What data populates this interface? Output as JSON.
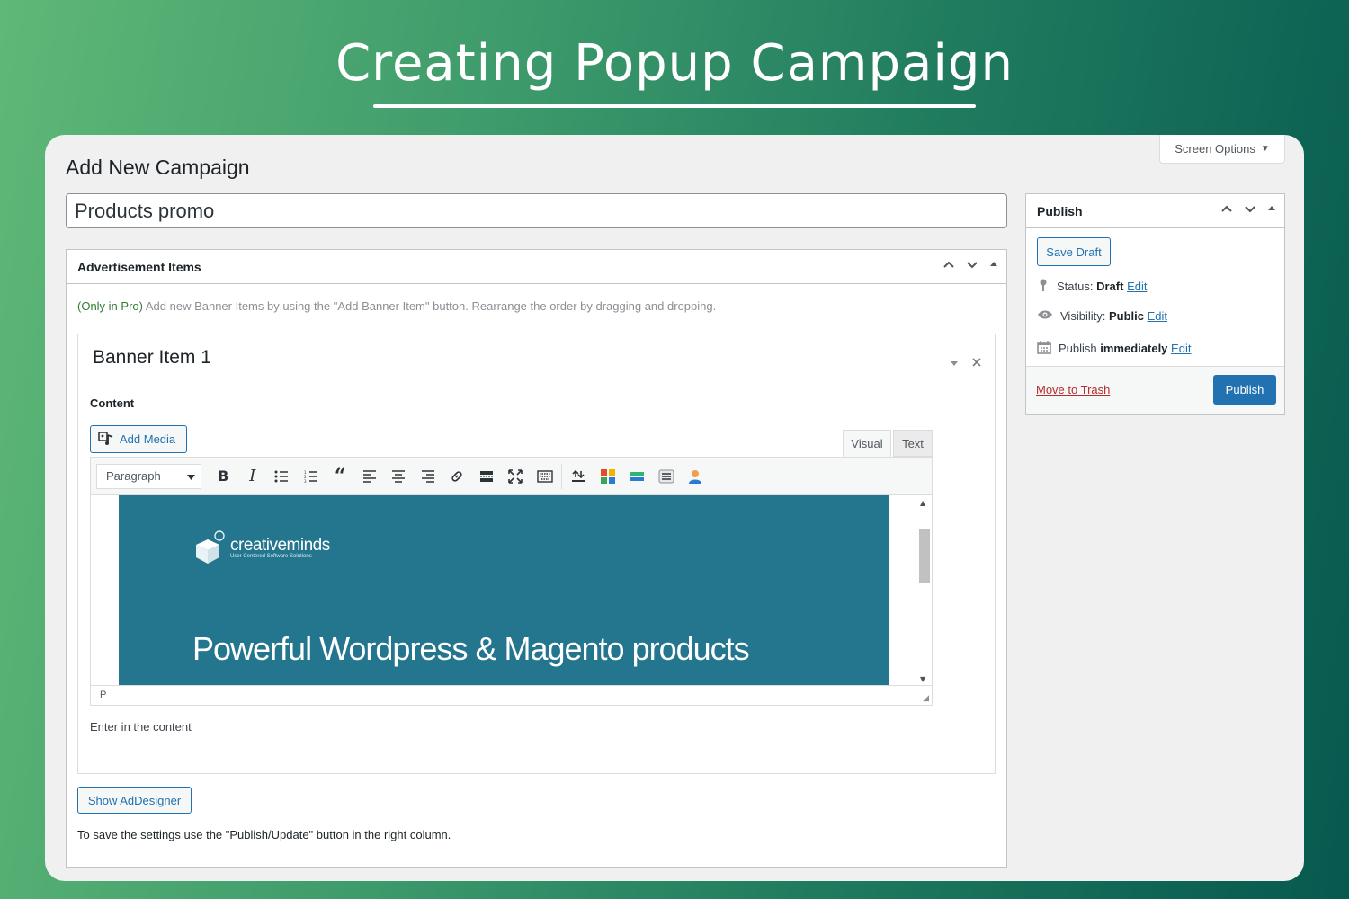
{
  "hero": {
    "title": "Creating Popup Campaign"
  },
  "screen_options": {
    "label": "Screen Options"
  },
  "page": {
    "title": "Add New Campaign"
  },
  "post_title": {
    "value": "Products promo"
  },
  "ads_box": {
    "title": "Advertisement Items",
    "note_pro": "(Only in Pro)",
    "note_text": " Add new Banner Items by using the \"Add Banner Item\" button. Rearrange the order by dragging and dropping.",
    "banner": {
      "title": "Banner Item 1",
      "content_label": "Content",
      "add_media_label": "Add Media",
      "tabs": {
        "visual": "Visual",
        "text": "Text"
      },
      "format_select": "Paragraph",
      "toolbar_icons": [
        "bold-icon",
        "italic-icon",
        "bullet-list-icon",
        "numbered-list-icon",
        "blockquote-icon",
        "align-left-icon",
        "align-center-icon",
        "align-right-icon",
        "link-icon",
        "read-more-icon",
        "fullscreen-icon",
        "keyboard-icon",
        "upload-icon",
        "grid-plugin-icon",
        "table-plugin-icon",
        "form-plugin-icon",
        "user-plugin-icon"
      ],
      "promo": {
        "logo_text": "creativeminds",
        "logo_sub": "User Centered Software Solutions",
        "headline": "Powerful Wordpress & Magento products",
        "bg_color": "#23768e"
      },
      "status_path": "P",
      "help_text": "Enter in the content"
    },
    "adesigner_label": "Show AdDesigner",
    "save_note": "To save the settings use the \"Publish/Update\" button in the right column."
  },
  "publish_box": {
    "title": "Publish",
    "save_draft_label": "Save Draft",
    "status_label": "Status:",
    "status_value": "Draft",
    "visibility_label": "Visibility:",
    "visibility_value": "Public",
    "publish_label": "Publish",
    "publish_value": "immediately",
    "edit_label": "Edit",
    "trash_label": "Move to Trash",
    "publish_button_label": "Publish",
    "accent_color": "#2271b1"
  }
}
